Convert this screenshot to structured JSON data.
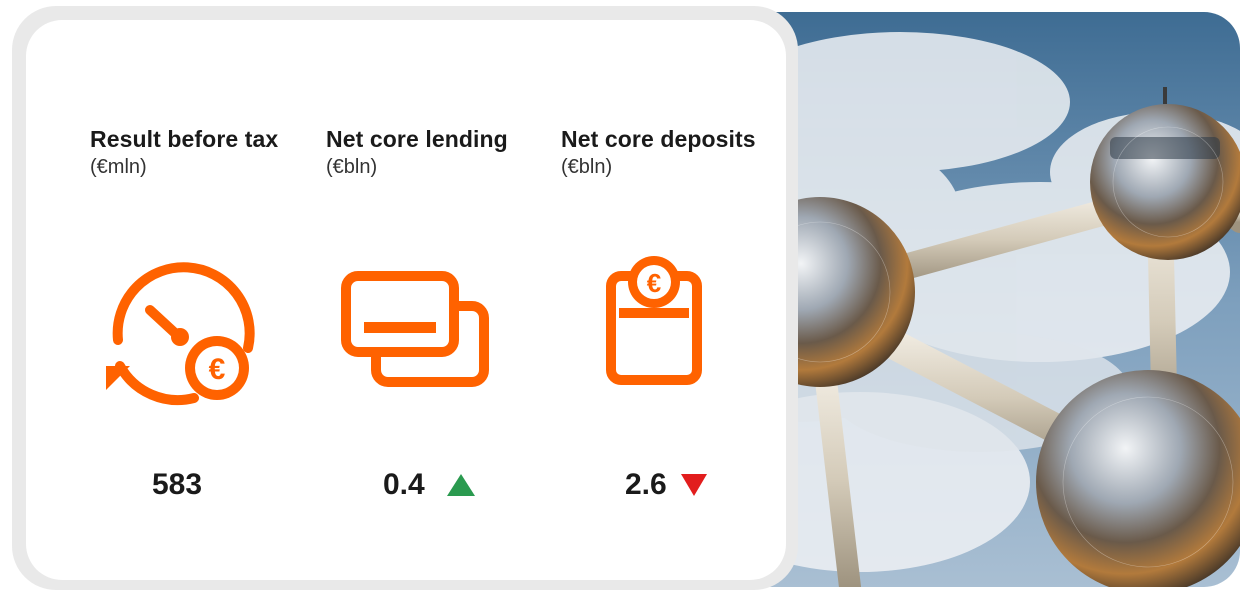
{
  "metrics": [
    {
      "title": "Result before tax",
      "unit": "(€mln)",
      "value": "583",
      "trend": "none",
      "icon": "clock-euro-icon"
    },
    {
      "title": "Net core lending",
      "unit": "(€bln)",
      "value": "0.4",
      "trend": "up",
      "icon": "credit-cards-icon"
    },
    {
      "title": "Net core deposits",
      "unit": "(€bln)",
      "value": "2.6",
      "trend": "down",
      "icon": "deposit-euro-icon"
    }
  ],
  "icon_glyph": "€",
  "colors": {
    "accent": "#ff6200",
    "up": "#2a9a4f",
    "down": "#e21d1d",
    "text": "#1a1a1a"
  },
  "photo": {
    "subject": "atomium-icon"
  }
}
